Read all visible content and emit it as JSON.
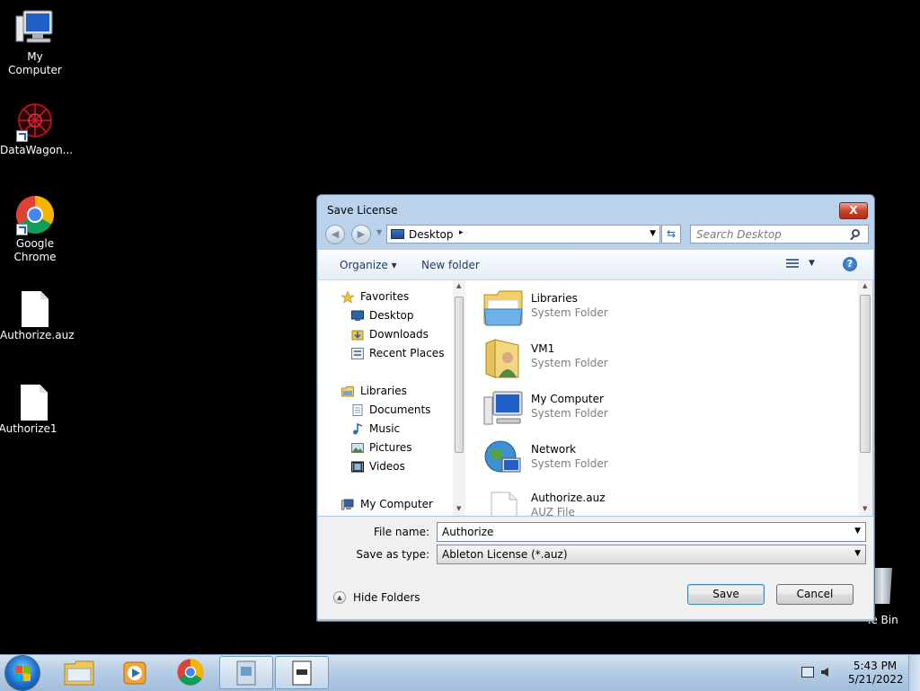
{
  "desktop": {
    "icons": [
      {
        "label": "My Computer"
      },
      {
        "label": "DataWagon..."
      },
      {
        "label": "Google Chrome"
      },
      {
        "label": "Authorize.auz"
      },
      {
        "label": "Authorize1"
      }
    ],
    "recycle_bin_label": "le Bin"
  },
  "dialog": {
    "title": "Save License",
    "close_glyph": "X",
    "address": {
      "location": "Desktop",
      "separator": "▸"
    },
    "search": {
      "placeholder": "Search Desktop"
    },
    "toolbar": {
      "organize": "Organize ▾",
      "new_folder": "New folder",
      "help": "?"
    },
    "nav": {
      "items": [
        {
          "label": "Favorites",
          "icon": "star-icon"
        },
        {
          "label": "Desktop",
          "icon": "desktop-icon"
        },
        {
          "label": "Downloads",
          "icon": "downloads-icon"
        },
        {
          "label": "Recent Places",
          "icon": "recent-places-icon"
        },
        {
          "label": "Libraries",
          "icon": "libraries-icon"
        },
        {
          "label": "Documents",
          "icon": "documents-icon"
        },
        {
          "label": "Music",
          "icon": "music-icon"
        },
        {
          "label": "Pictures",
          "icon": "pictures-icon"
        },
        {
          "label": "Videos",
          "icon": "videos-icon"
        },
        {
          "label": "My Computer",
          "icon": "computer-icon"
        }
      ]
    },
    "files": [
      {
        "name": "Libraries",
        "type": "System Folder",
        "icon": "libraries-folder-icon"
      },
      {
        "name": "VM1",
        "type": "System Folder",
        "icon": "user-folder-icon"
      },
      {
        "name": "My Computer",
        "type": "System Folder",
        "icon": "computer-icon"
      },
      {
        "name": "Network",
        "type": "System Folder",
        "icon": "network-icon"
      },
      {
        "name": "Authorize.auz",
        "type": "AUZ File",
        "icon": "file-icon"
      }
    ],
    "form": {
      "file_name_label": "File name:",
      "file_name_value": "Authorize",
      "save_type_label": "Save as type:",
      "save_type_value": "Ableton License (*.auz)"
    },
    "hide_folders": "Hide Folders",
    "save": "Save",
    "cancel": "Cancel"
  },
  "taskbar": {
    "time": "5:43 PM",
    "date": "5/21/2022"
  }
}
